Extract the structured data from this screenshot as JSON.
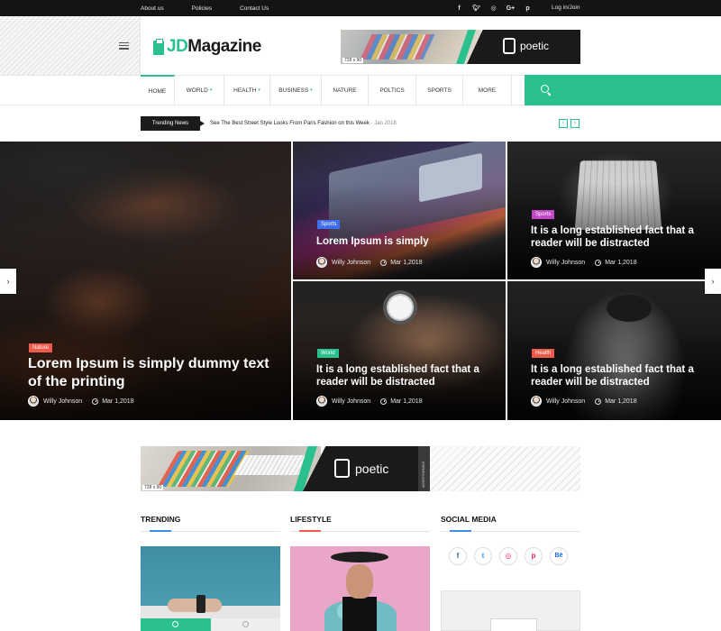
{
  "topbar": {
    "links": [
      "About us",
      "Policies",
      "Contact Us"
    ],
    "social": [
      "f",
      "t",
      "ig",
      "G+",
      "p"
    ],
    "login": "Log in/Join"
  },
  "header": {
    "logo_accent": "JD",
    "logo_main": "Magazine",
    "ad_size": "728 x 90",
    "ad_brand": "poetic"
  },
  "nav": {
    "items": [
      {
        "label": "HOME",
        "dropdown": false
      },
      {
        "label": "WORLD",
        "dropdown": true
      },
      {
        "label": "HEALTH",
        "dropdown": true
      },
      {
        "label": "BUSINESS",
        "dropdown": true
      },
      {
        "label": "NATURE",
        "dropdown": false
      },
      {
        "label": "POLTICS",
        "dropdown": false
      },
      {
        "label": "SPORTS",
        "dropdown": false
      },
      {
        "label": "MORE",
        "dropdown": false
      }
    ]
  },
  "trending_bar": {
    "label": "Trending News",
    "headline": "See The Best Street Style Looks From Paris Fashion on this Week",
    "date": " - Jan 2018"
  },
  "hero": {
    "big": {
      "category": "Nature",
      "title": "Lorem Ipsum is simply dummy text of the printing",
      "author": "Willy Johnson",
      "date": "Mar 1,2018"
    },
    "card1": {
      "category": "Sports",
      "title": "Lorem Ipsum is simply",
      "author": "Willy Johnson",
      "date": "Mar 1,2018"
    },
    "card2": {
      "category": "Sports",
      "title": "It is a long established fact that a reader will be distracted",
      "author": "Willy Johnson",
      "date": "Mar 1,2018"
    },
    "card3": {
      "category": "World",
      "title": "It is a long established fact that a reader will be distracted",
      "author": "Willy Johnson",
      "date": "Mar 1,2018"
    },
    "card4": {
      "category": "Health",
      "title": "It is a long established fact that a reader will be distracted",
      "author": "Willy Johnson",
      "date": "Mar 1,2018"
    }
  },
  "mid_ad": {
    "size": "728 x 90",
    "brand": "poetic",
    "side_label": "ADVERTISEMENT"
  },
  "sections": {
    "trending": "TRENDING",
    "lifestyle": "LIFESTYLE",
    "social": "SOCIAL MEDIA",
    "social_icons": [
      "f",
      "t",
      "◎",
      "p",
      "Bē"
    ]
  },
  "colors": {
    "accent": "#2ac18e",
    "nature": "#f05a4a",
    "sports": "#3f6fe8",
    "sports2": "#c447c9",
    "world": "#2ac18e",
    "health": "#f05a4a",
    "trending_line": "#3f8ee8",
    "lifestyle_line": "#f05a4a",
    "social_line": "#3f8ee8"
  }
}
